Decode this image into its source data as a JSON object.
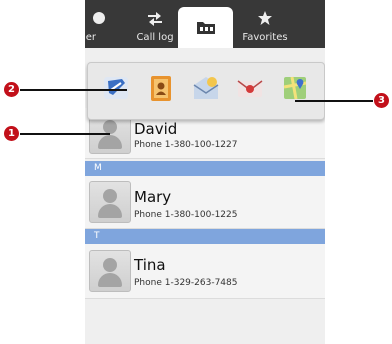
{
  "tabs": [
    {
      "label": "ler",
      "icon": "phone-icon",
      "active": false
    },
    {
      "label": "Call log",
      "icon": "call-log-icon",
      "active": false
    },
    {
      "label": "",
      "icon": "contacts-folder-icon",
      "active": true
    },
    {
      "label": "Favorites",
      "icon": "star-icon",
      "active": false
    }
  ],
  "quick_actions": [
    {
      "icon": "dial-icon"
    },
    {
      "icon": "contact-details-icon"
    },
    {
      "icon": "message-icon"
    },
    {
      "icon": "email-icon"
    },
    {
      "icon": "map-icon"
    }
  ],
  "contacts": [
    {
      "name": "David",
      "phone": "Phone 1-380-100-1227"
    },
    {
      "name": "Mary",
      "phone": "Phone 1-380-100-1225"
    },
    {
      "name": "Tina",
      "phone": "Phone 1-329-263-7485"
    }
  ],
  "sections": [
    "M",
    "T"
  ],
  "callouts": [
    "1",
    "2",
    "3"
  ],
  "colors": {
    "section_header": "#7fa5dd",
    "callout": "#c2101a",
    "tabbar": "#383838"
  }
}
